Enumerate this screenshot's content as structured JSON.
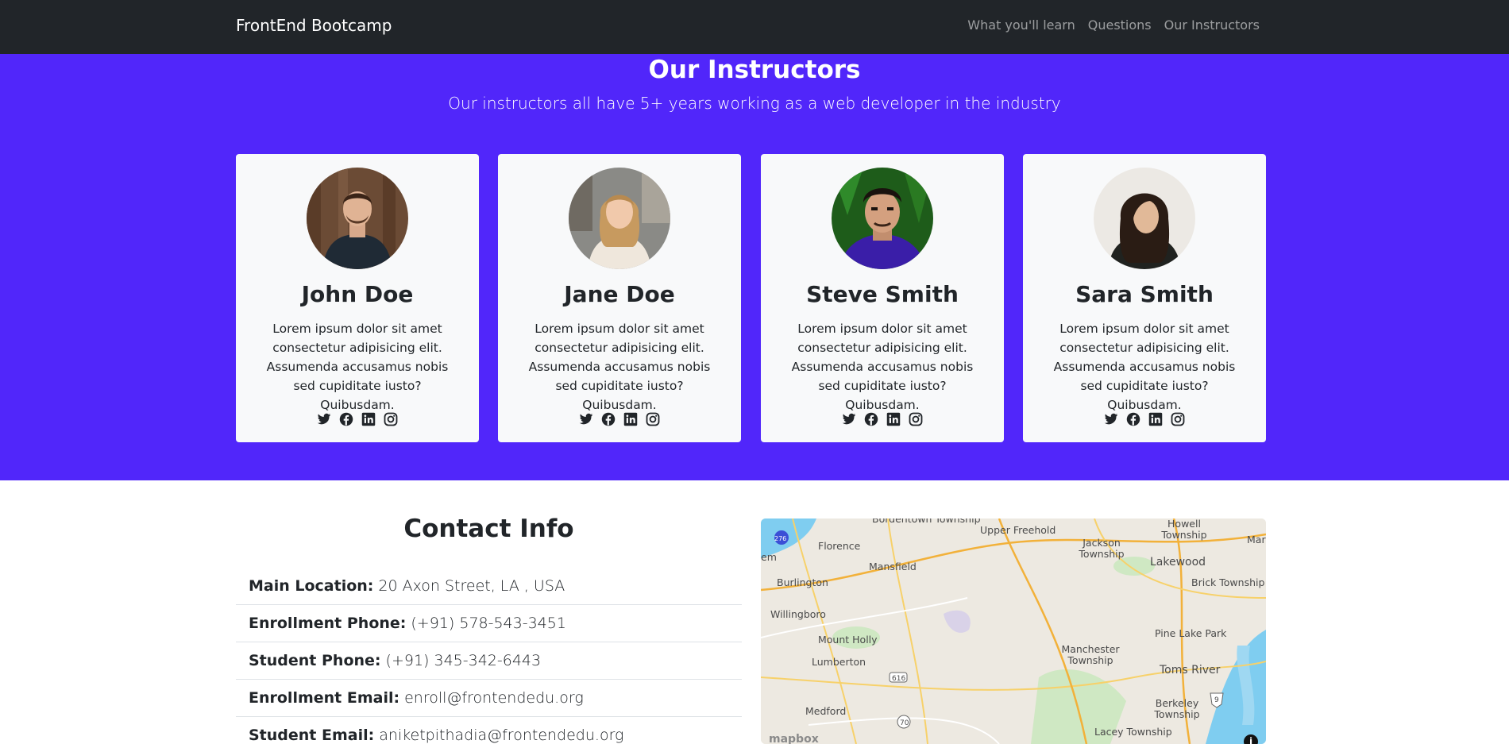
{
  "navbar": {
    "brand": "FrontEnd Bootcamp",
    "links": [
      "What you'll learn",
      "Questions",
      "Our Instructors"
    ]
  },
  "instructors": {
    "title": "Our Instructors",
    "lead": "Our instructors all have 5+ years working as a web developer in the industry",
    "cards": [
      {
        "name": "John Doe",
        "bio": "Lorem ipsum dolor sit amet consectetur adipisicing elit. Assumenda accusamus nobis sed cupiditate iusto? Quibusdam."
      },
      {
        "name": "Jane Doe",
        "bio": "Lorem ipsum dolor sit amet consectetur adipisicing elit. Assumenda accusamus nobis sed cupiditate iusto? Quibusdam."
      },
      {
        "name": "Steve Smith",
        "bio": "Lorem ipsum dolor sit amet consectetur adipisicing elit. Assumenda accusamus nobis sed cupiditate iusto? Quibusdam."
      },
      {
        "name": "Sara Smith",
        "bio": "Lorem ipsum dolor sit amet consectetur adipisicing elit. Assumenda accusamus nobis sed cupiditate iusto? Quibusdam."
      }
    ],
    "social_icons": [
      "twitter-icon",
      "facebook-icon",
      "linkedin-icon",
      "instagram-icon"
    ]
  },
  "contact": {
    "title": "Contact Info",
    "items": [
      {
        "label": "Main Location:",
        "value": "20 Axon Street, LA , USA"
      },
      {
        "label": "Enrollment Phone:",
        "value": "(+91) 578-543-3451"
      },
      {
        "label": "Student Phone:",
        "value": "(+91) 345-342-6443"
      },
      {
        "label": "Enrollment Email:",
        "value": "enroll@frontendedu.org"
      },
      {
        "label": "Student Email:",
        "value": "aniketpithadia@frontendedu.org"
      }
    ]
  },
  "map": {
    "places": [
      "Bordentown Township",
      "Upper Freehold",
      "Howell Township",
      "Florence",
      "Jackson Township",
      "Lakewood",
      "Mansfield",
      "Burlington",
      "Brick Township",
      "Willingboro",
      "Mount Holly",
      "Pine Lake Park",
      "Manchester Township",
      "Lumberton",
      "Toms River",
      "Medford",
      "Berkeley Township",
      "Lacey Township",
      "em",
      "Mar"
    ],
    "route_shields": [
      "276",
      "616",
      "70",
      "9"
    ],
    "attribution": "mapbox",
    "info_button": "i"
  },
  "colors": {
    "navbar_bg": "#212529",
    "section_bg": "#5126fa",
    "card_bg": "#f8f9fa"
  }
}
